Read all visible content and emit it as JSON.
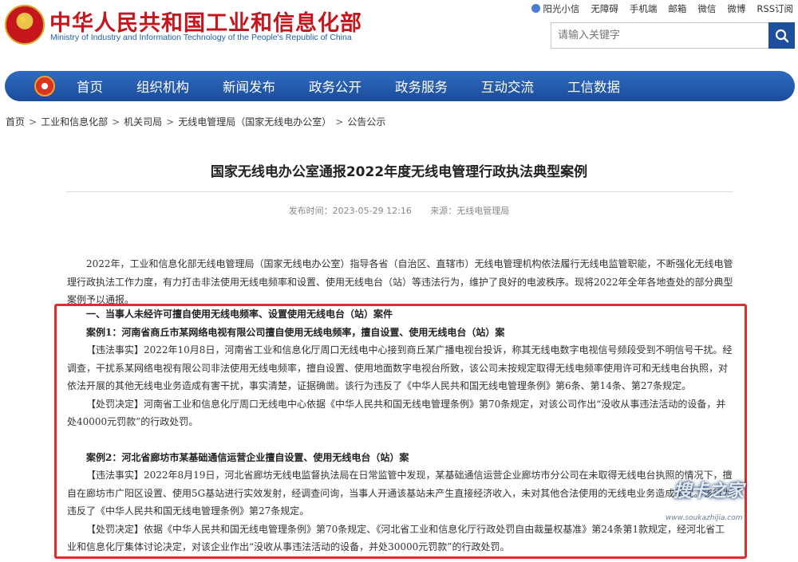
{
  "header": {
    "title": "中华人民共和国工业和信息化部",
    "subtitle": "Ministry of Industry and Information Technology of the People's Republic of China",
    "top_links": [
      "阳光小信",
      "无障碍",
      "手机端",
      "邮箱",
      "微信",
      "微博",
      "RSS订阅"
    ]
  },
  "search": {
    "placeholder": "请输入关键字",
    "icon": "search-icon"
  },
  "nav": {
    "items": [
      "首页",
      "组织机构",
      "新闻发布",
      "政务公开",
      "政务服务",
      "互动交流",
      "工信数据"
    ]
  },
  "breadcrumb": [
    "首页",
    "工业和信息化部",
    "机关司局",
    "无线电管理局（国家无线电办公室）",
    "公告公示"
  ],
  "article": {
    "title": "国家无线电办公室通报2022年度无线电管理行政执法典型案例",
    "publish_time": "发布时间：2023-05-29 12:16",
    "source": "来源：无线电管理局",
    "intro": "2022年，工业和信息化部无线电管理局（国家无线电办公室）指导各省（自治区、直辖市）无线电管理机构依法履行无线电监管职能，不断强化无线电管理行政执法工作力度，有力打击非法使用无线电频率和设置、使用无线电台（站）等违法行为，维护了良好的电波秩序。现将2022年全年各地查处的部分典型案例予以通报。",
    "section1": "一、当事人未经许可擅自使用无线电频率、设置使用无线电台（站）案件",
    "case1_title": "案例1：河南省商丘市某网络电视有限公司擅自使用无线电频率，擅自设置、使用无线电台（站）案",
    "case1_facts": "【违法事实】2022年10月8日，河南省工业和信息化厅周口无线电中心接到商丘某广播电视台投诉，称其无线电数字电视信号频段受到不明信号干扰。经调查，干扰系某网络电视有限公司非法使用无线电频率，擅自设置、使用地面数字电视台所致，该公司未按规定取得无线电频率使用许可和无线电台执照，对依法开展的其他无线电业务造成有害干扰，事实清楚，证据确凿。该行为违反了《中华人民共和国无线电管理条例》第6条、第14条、第27条规定。",
    "case1_penalty": "【处罚决定】河南省工业和信息化厅周口无线电中心依据《中华人民共和国无线电管理条例》第70条规定，对该公司作出“没收从事违法活动的设备，并处40000元罚款”的行政处罚。",
    "case2_title": "案例2：河北省廊坊市某基础通信运营企业擅自设置、使用无线电台（站）案",
    "case2_facts": "【违法事实】2022年8月19日，河北省廊坊无线电监督执法局在日常监管中发现，某基础通信运营企业廊坊市分公司在未取得无线电台执照的情况下，擅自在廊坊市广阳区设置、使用5G基站进行实效发射，经调查问询，当事人开通该基站未产生直接经济收入，未对其他合法使用的无线电业务造成干扰。该行为违反了《中华人民共和国无线电管理条例》第27条规定。",
    "case2_penalty": "【处罚决定】依据《中华人民共和国无线电管理条例》第70条规定、《河北省工业和信息化厅行政处罚自由裁量权基准》第24条第1款规定，经河北省工业和信息化厅集体讨论决定，对该企业作出“没收从事违法活动的设备，并处30000元罚款”的行政处罚。"
  },
  "watermark": {
    "main": "搜卡之家",
    "sub": "www.soukazhijia.com"
  },
  "colors": {
    "brand_red": "#c4161c",
    "nav_blue": "#1b4c9a",
    "highlight_frame": "#e42b2b"
  }
}
